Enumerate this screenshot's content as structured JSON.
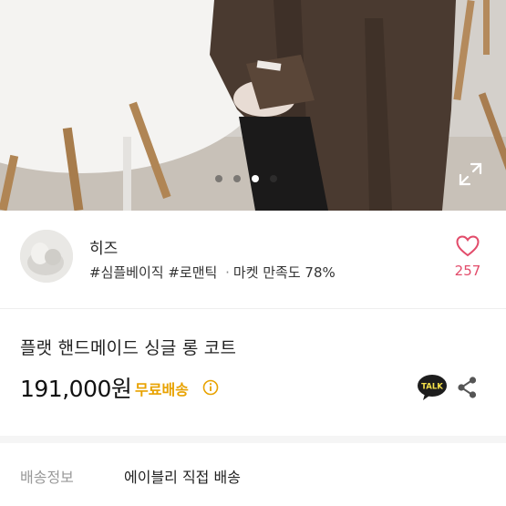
{
  "carousel": {
    "total": 4,
    "active_index": 2
  },
  "seller": {
    "name": "히즈",
    "tag1": "#심플베이직",
    "tag2": "#로맨틱",
    "separator": "·",
    "satisfaction": "마켓 만족도 78%",
    "like_count": "257"
  },
  "product": {
    "title": "플랫 핸드메이드 싱글 롱 코트",
    "price": "191,000원",
    "shipping_badge": "무료배송",
    "talk_label": "TALK"
  },
  "delivery": {
    "label": "배송정보",
    "value": "에이블리 직접 배송"
  },
  "colors": {
    "accent_pink": "#e24b6a",
    "shipping_badge": "#e8a200",
    "coat_brown": "#4a3a30"
  },
  "icons": [
    "expand-icon",
    "heart-icon",
    "info-icon",
    "kakao-talk-icon",
    "share-icon"
  ]
}
